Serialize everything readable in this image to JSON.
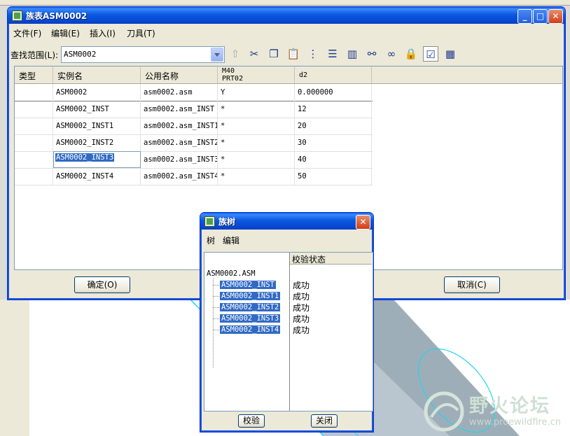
{
  "main_window": {
    "title": "族表ASM0002",
    "menu": [
      "文件(F)",
      "编辑(E)",
      "插入(I)",
      "刀具(T)"
    ],
    "find_label": "查找范围(L):",
    "find_value": "ASM0002",
    "toolbar_icons": [
      "up-folder-icon",
      "cut-icon",
      "copy-icon",
      "paste-icon",
      "insert-column-icon",
      "insert-row-icon",
      "column-format-icon",
      "binoculars-icon",
      "glasses-icon",
      "lock-icon",
      "verify-table-icon",
      "table-view-icon"
    ],
    "columns": [
      "类型",
      "实例名",
      "公用名称",
      "M40\nPRT02",
      "d2"
    ],
    "rows": [
      [
        "",
        "ASM0002",
        "asm0002.asm",
        "Y",
        "0.000000"
      ],
      [
        "",
        "ASM0002_INST",
        "asm0002.asm_INST",
        "*",
        "12"
      ],
      [
        "",
        "ASM0002_INST1",
        "asm0002.asm_INST1",
        "*",
        "20"
      ],
      [
        "",
        "ASM0002_INST2",
        "asm0002.asm_INST2",
        "*",
        "30"
      ],
      [
        "",
        "ASM0002_INST3",
        "asm0002.asm_INST3",
        "*",
        "40"
      ],
      [
        "",
        "ASM0002_INST4",
        "asm0002.asm_INST4",
        "*",
        "50"
      ]
    ],
    "ok_label": "确定(O)",
    "cancel_label": "取消(C)"
  },
  "tree_dialog": {
    "title": "族树",
    "menu": [
      "树",
      "编辑"
    ],
    "status_header": "校验状态",
    "root": "ASM0002.ASM",
    "children": [
      "ASM0002_INST",
      "ASM0002_INST1",
      "ASM0002_INST2",
      "ASM0002_INST3",
      "ASM0002_INST4"
    ],
    "statuses": [
      "成功",
      "成功",
      "成功",
      "成功",
      "成功"
    ],
    "verify_label": "校验",
    "close_label": "关闭"
  },
  "watermark": {
    "title": "野火论坛",
    "url": "www.proewildfire.cn"
  }
}
